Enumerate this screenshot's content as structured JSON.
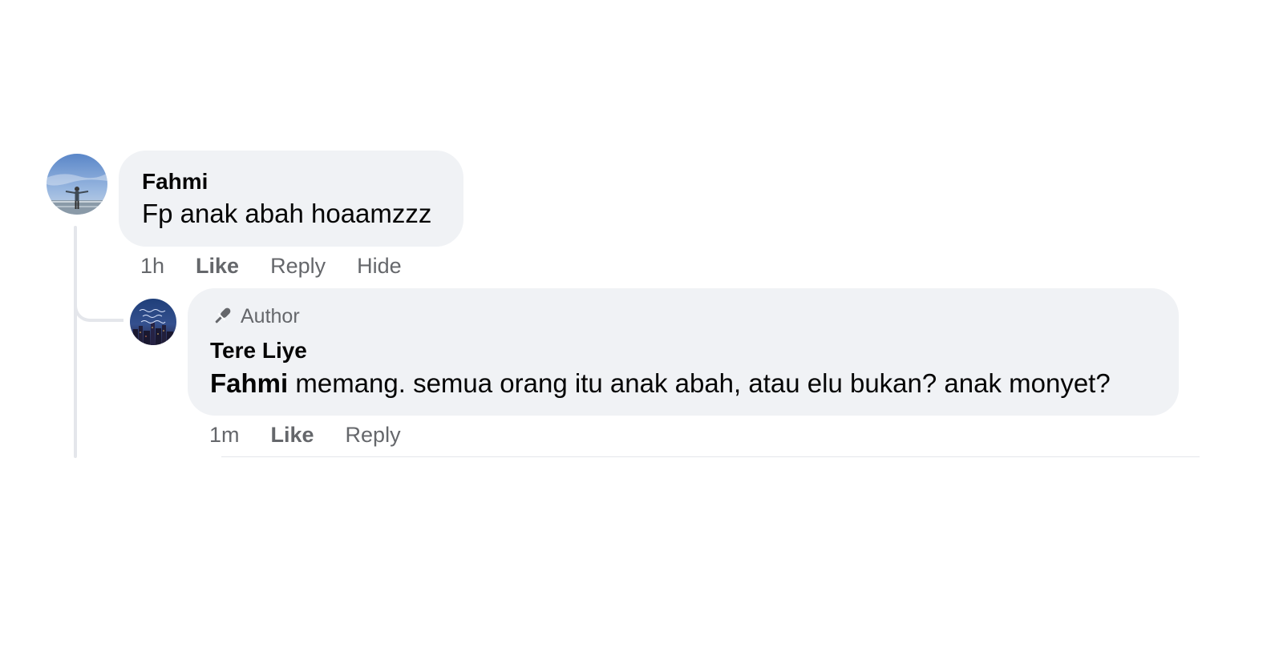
{
  "comment": {
    "author": "Fahmi",
    "text": "Fp anak abah hoaamzzz",
    "avatar_icon": "profile-photo-person-sky",
    "actions": {
      "timestamp": "1h",
      "like_label": "Like",
      "reply_label": "Reply",
      "hide_label": "Hide"
    }
  },
  "reply": {
    "badge_icon": "microphone-icon",
    "badge_label": "Author",
    "author": "Tere Liye",
    "mention": "Fahmi",
    "text": " memang. semua orang itu anak abah, atau elu bukan? anak monyet?",
    "avatar_icon": "page-avatar-city-night",
    "actions": {
      "timestamp": "1m",
      "like_label": "Like",
      "reply_label": "Reply"
    }
  },
  "colors": {
    "bubble_bg": "#f0f2f5",
    "secondary_text": "#65676b",
    "primary_text": "#050505",
    "thread_line": "#e4e6eb"
  }
}
